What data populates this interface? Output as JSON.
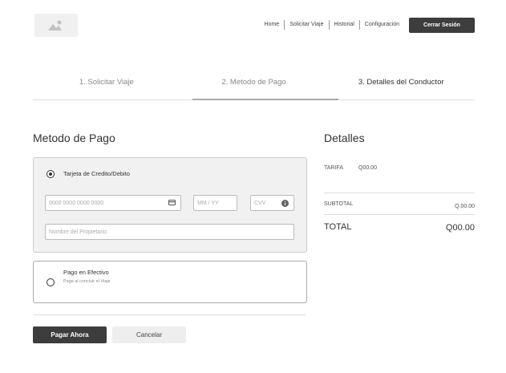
{
  "header": {
    "nav": [
      "Home",
      "Solicitar Viaje",
      "Historial",
      "Configuración"
    ],
    "logout_label": "Cerrar Sesión"
  },
  "steps": [
    "1. Solicitar Viaje",
    "2. Metodo de Pago",
    "3. Detalles del Conductor"
  ],
  "payment": {
    "title": "Metodo de Pago",
    "card_option_label": "Tarjeta de Credito/Debito",
    "card_number_placeholder": "0000  0000  0000  0000",
    "expiry_placeholder": "MM / YY",
    "cvv_placeholder": "CVV",
    "owner_placeholder": "Nombre del Propietario",
    "cash_option_label": "Pago en Efectivo",
    "cash_option_sub": "Paga al concluir el Viaje"
  },
  "details": {
    "title": "Detalles",
    "tarifa_label": "TARIFA",
    "tarifa_value": "Q00.00",
    "subtotal_label": "SUBTOTAL",
    "subtotal_value": "Q.00.00",
    "total_label": "TOTAL",
    "total_value": "Q00.00"
  },
  "actions": {
    "pay_label": "Pagar Ahora",
    "cancel_label": "Cancelar"
  }
}
